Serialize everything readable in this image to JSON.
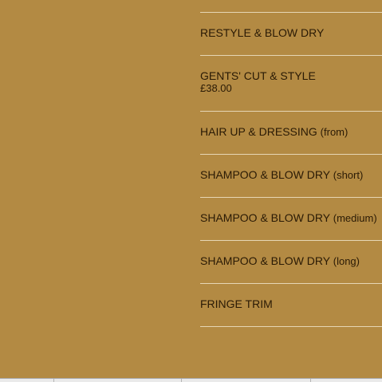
{
  "services": [
    {
      "name": "RESTYLE & BLOW DRY",
      "suffix": "",
      "price": ""
    },
    {
      "name": "GENTS' CUT & STYLE",
      "suffix": "",
      "price": "£38.00"
    },
    {
      "name": "HAIR UP & DRESSING",
      "suffix": "(from)",
      "price": ""
    },
    {
      "name": "SHAMPOO & BLOW DRY",
      "suffix": "(short)",
      "price": ""
    },
    {
      "name": "SHAMPOO & BLOW DRY",
      "suffix": "(medium)",
      "price": ""
    },
    {
      "name": "SHAMPOO & BLOW DRY",
      "suffix": "(long)",
      "price": ""
    },
    {
      "name": "FRINGE TRIM",
      "suffix": "",
      "price": ""
    }
  ],
  "colors": {
    "background": "#b38a43",
    "divider": "#e6d6b5",
    "text": "#2a1a05"
  }
}
